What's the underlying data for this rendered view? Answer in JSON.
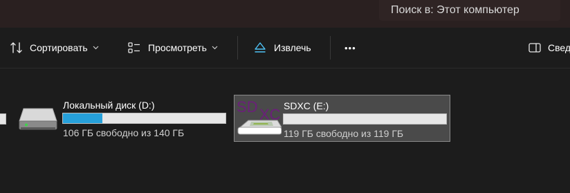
{
  "search": {
    "text": "Поиск в: Этот компьютер"
  },
  "toolbar": {
    "sort_label": "Сортировать",
    "view_label": "Просмотреть",
    "eject_label": "Извлечь",
    "more_label": "•••",
    "details_label": "Свед"
  },
  "drives": [
    {
      "name": "Локальный диск (D:)",
      "free_text": "106 ГБ свободно из 140 ГБ",
      "used_fraction": 0.243,
      "icon": "hard-drive-icon"
    },
    {
      "name": "SDXC (E:)",
      "free_text": "119 ГБ свободно из 119 ГБ",
      "used_fraction": 0.0,
      "icon": "sd-card-icon",
      "icon_text_top": "SD",
      "icon_text_bottom": "XC",
      "selected": true
    }
  ],
  "colors": {
    "usage_bar": "#26a0da",
    "selection_bg": "#4a4a4a",
    "sdxc_logo": "#6b1f7a"
  }
}
